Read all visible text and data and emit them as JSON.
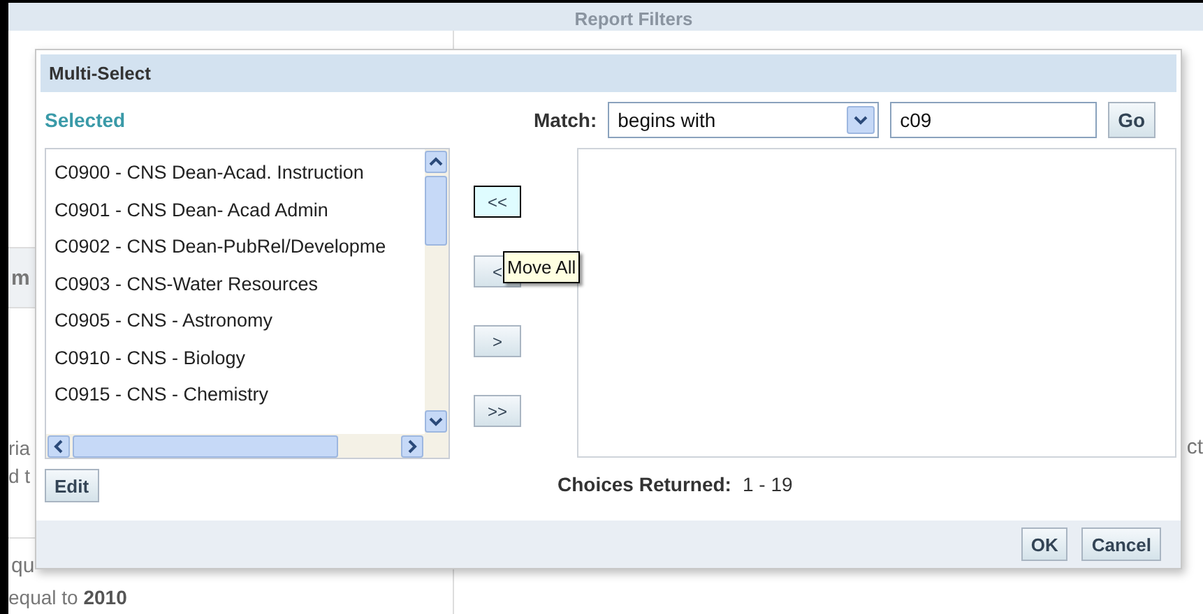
{
  "background": {
    "title": "Report Filters",
    "left_fragments": [
      {
        "text": "m",
        "kind": "header"
      },
      {
        "text": "ria",
        "kind": "line"
      },
      {
        "text": "d t",
        "kind": "line"
      },
      {
        "text": "qu",
        "kind": "divided"
      },
      {
        "text": "equal to **2010**",
        "kind": "line"
      }
    ],
    "right_fragment": "ct"
  },
  "dialog": {
    "title": "Multi-Select",
    "selected_label": "Selected",
    "selected_items": [
      "C0900 - CNS Dean-Acad. Instruction",
      "C0901 - CNS Dean- Acad Admin",
      "C0902 - CNS Dean-PubRel/Developme",
      "C0903 - CNS-Water Resources",
      "C0905 - CNS - Astronomy",
      "C0910 - CNS - Biology",
      "C0915 - CNS - Chemistry"
    ],
    "move_buttons": [
      {
        "label": "<<",
        "focused": true
      },
      {
        "label": "<",
        "focused": false
      },
      {
        "label": ">",
        "focused": false
      },
      {
        "label": ">>",
        "focused": false
      }
    ],
    "tooltip": "Move All",
    "match_label": "Match:",
    "match_select": "begins with",
    "search_value": "c09",
    "go_button": "Go",
    "edit_button": "Edit",
    "choices_label": "Choices Returned:",
    "choices_value": "1 - 19",
    "footer_buttons": [
      "OK",
      "Cancel"
    ]
  }
}
